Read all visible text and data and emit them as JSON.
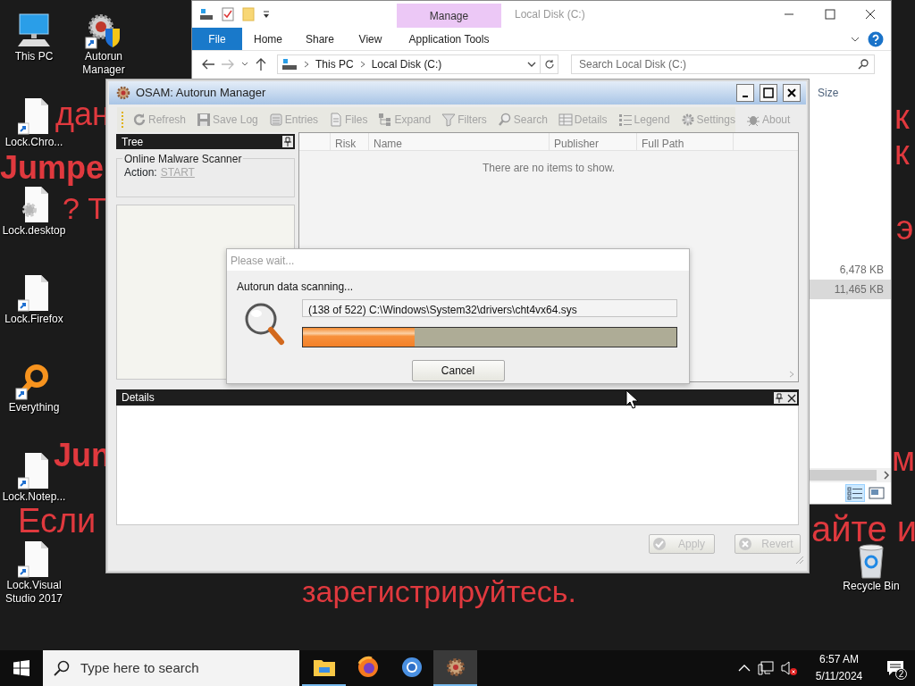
{
  "desktop": {
    "wallpaper_texts": [
      "дан",
      "к",
      "Jumpe",
      "к",
      "? Т",
      "э",
      "Jun",
      "м",
      "Если",
      "айте и",
      "зарегистрируйтесь."
    ],
    "icons": [
      {
        "label": "This PC",
        "kind": "computer",
        "shortcut": false
      },
      {
        "label": "Autorun Manager",
        "kind": "app",
        "shortcut": true
      },
      {
        "label": "Lock.Chro...",
        "kind": "file",
        "shortcut": true
      },
      {
        "label": "Lock.desktop",
        "kind": "gear-file",
        "shortcut": false
      },
      {
        "label": "Lock.Firefox",
        "kind": "file",
        "shortcut": true
      },
      {
        "label": "Everything",
        "kind": "search",
        "shortcut": true
      },
      {
        "label": "Lock.Notep...",
        "kind": "file",
        "shortcut": true
      },
      {
        "label": "Lock.Visual Studio 2017",
        "kind": "file",
        "shortcut": true
      },
      {
        "label": "Recycle Bin",
        "kind": "recycle",
        "shortcut": false
      }
    ]
  },
  "explorer": {
    "title": "Local Disk (C:)",
    "context_group": "Manage",
    "file_tab": "File",
    "ribbon_tabs": [
      "Home",
      "Share",
      "View",
      "Application Tools"
    ],
    "breadcrumb": [
      "This PC",
      "Local Disk (C:)"
    ],
    "search": {
      "placeholder": "Search Local Disk (C:)"
    },
    "column": "Size",
    "sizes": [
      {
        "text": "6,478 KB",
        "selected": false
      },
      {
        "text": "11,465 KB",
        "selected": true
      }
    ]
  },
  "app": {
    "title": "OSAM: Autorun Manager",
    "toolbar": [
      {
        "label": "Refresh",
        "kind": "refresh",
        "disabled": true
      },
      {
        "label": "Save Log",
        "kind": "save",
        "disabled": true
      },
      {
        "label": "Entries",
        "kind": "entries",
        "disabled": true
      },
      {
        "label": "Files",
        "kind": "files",
        "disabled": true
      },
      {
        "label": "Expand",
        "kind": "expand",
        "disabled": true
      },
      {
        "label": "Filters",
        "kind": "filters",
        "disabled": true
      },
      {
        "label": "Search",
        "kind": "search",
        "disabled": true
      },
      {
        "label": "Details",
        "kind": "details",
        "disabled": true
      },
      {
        "label": "Legend",
        "kind": "legend",
        "disabled": true
      },
      {
        "label": "Settings",
        "kind": "settings",
        "disabled": true
      },
      {
        "label": "About",
        "kind": "about",
        "disabled": true
      }
    ],
    "tree": {
      "title": "Tree",
      "group": "Online Malware Scanner",
      "action_label": "Action:",
      "action_link": "START"
    },
    "columns": [
      "Risk",
      "Name",
      "Publisher",
      "Full Path"
    ],
    "empty_message": "There are no items to show.",
    "details_title": "Details",
    "buttons": [
      {
        "label": "Apply",
        "kind": "apply",
        "disabled": true
      },
      {
        "label": "Revert",
        "kind": "revert",
        "disabled": true
      }
    ]
  },
  "dialog": {
    "title": "Please wait...",
    "message": "Autorun data scanning...",
    "current_file": "(138 of 522) C:\\Windows\\System32\\drivers\\cht4vx64.sys",
    "level": 0.3,
    "button": "Cancel"
  },
  "taskbar": {
    "search": {
      "placeholder": "Type here to search"
    },
    "apps": [
      {
        "kind": "explorer",
        "selected": false,
        "running": true
      },
      {
        "kind": "firefox",
        "selected": false,
        "running": false
      },
      {
        "kind": "chrome",
        "selected": false,
        "running": false
      },
      {
        "kind": "osam",
        "selected": true,
        "running": true
      }
    ],
    "time": "6:57 AM",
    "date": "5/11/2024",
    "notification_count": "2"
  }
}
